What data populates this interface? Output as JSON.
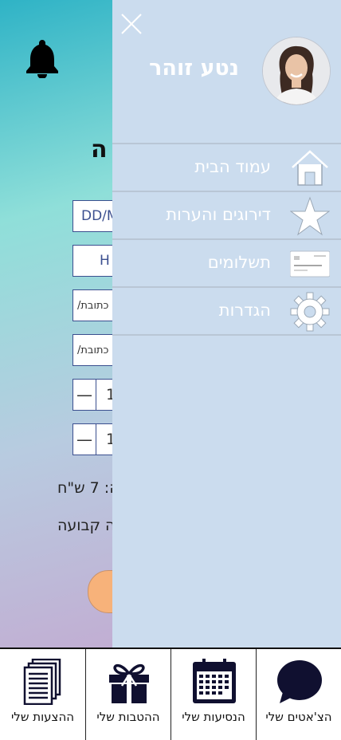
{
  "background": {
    "title": "ה",
    "date_field": "DD/M",
    "time_field": "H",
    "from_field": "/כתובת",
    "to_field": "/כתובת",
    "stepper1_value": "1",
    "stepper2_value": "1",
    "price_text": "ה: 7 ש\"ח",
    "fixed_text": "ה קבועה"
  },
  "drawer": {
    "user_name": "נטע זוהר",
    "items": [
      {
        "label": "עמוד הבית",
        "icon": "home-icon"
      },
      {
        "label": "דירוגים והערות",
        "icon": "star-icon"
      },
      {
        "label": "תשלומים",
        "icon": "credit-card-icon"
      },
      {
        "label": "הגדרות",
        "icon": "gear-icon"
      }
    ]
  },
  "bottom_nav": {
    "items": [
      {
        "label": "הצ'אטים שלי",
        "icon": "chat-bubble-icon"
      },
      {
        "label": "הנסיעות שלי",
        "icon": "calendar-icon"
      },
      {
        "label": "ההטבות שלי",
        "icon": "gift-icon"
      },
      {
        "label": "ההצעות שלי",
        "icon": "documents-icon"
      }
    ]
  },
  "colors": {
    "drawer_bg": "#cbdcee",
    "divider": "#b9c6d5",
    "accent_button": "#f7b27a"
  }
}
